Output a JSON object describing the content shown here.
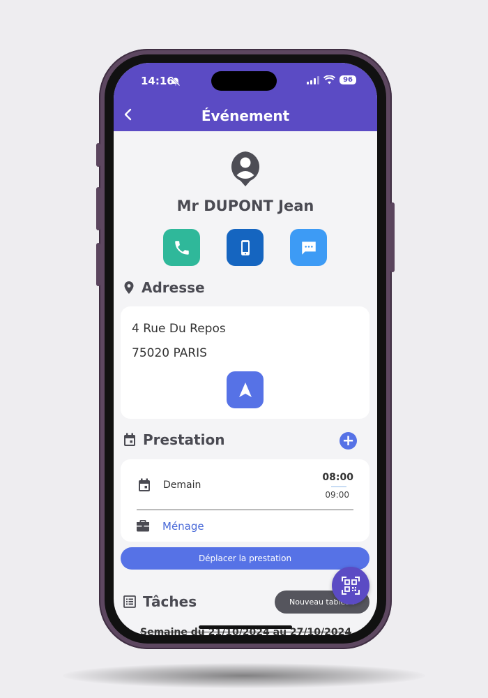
{
  "status_bar": {
    "time": "14:16",
    "battery": "96"
  },
  "header": {
    "title": "Événement"
  },
  "contact": {
    "name": "Mr DUPONT Jean"
  },
  "actions": {
    "phone_icon": "phone-icon",
    "mobile_icon": "mobile-icon",
    "sms_icon": "message-icon"
  },
  "address": {
    "section_title": "Adresse",
    "line1": "4 Rue Du Repos",
    "line2": "75020 PARIS"
  },
  "prestation": {
    "section_title": "Prestation",
    "date_label": "Demain",
    "start_time": "08:00",
    "end_time": "09:00",
    "service": "Ménage",
    "move_button": "Déplacer la prestation"
  },
  "tasks": {
    "section_title": "Tâches",
    "new_board_button": "Nouveau tableau",
    "week_label": "Semaine du 21/10/2024 au 27/10/2024"
  },
  "colors": {
    "primary": "#5b4bc4",
    "accent": "#5672e6",
    "phone_green": "#2fb89a",
    "mobile_blue": "#1565c0",
    "sms_blue": "#3d9bf5"
  }
}
